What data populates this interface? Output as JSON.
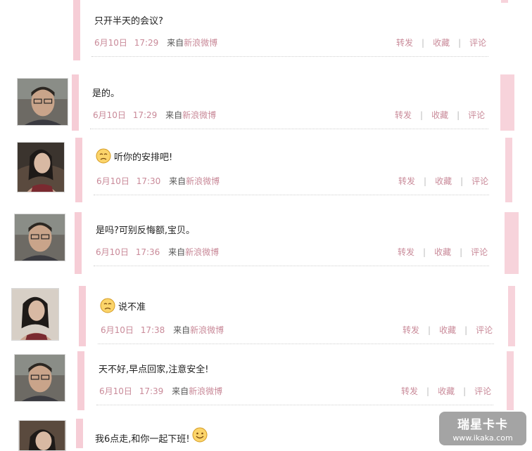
{
  "posts": [
    {
      "text": "只开半天的会议?",
      "date": "6月10日",
      "time": "17:29",
      "source_prefix": "来自",
      "source": "新浪微博",
      "actions": [
        "转发",
        "收藏",
        "评论"
      ],
      "avatar": "none",
      "emoji": ""
    },
    {
      "text": "是的。",
      "date": "6月10日",
      "time": "17:29",
      "source_prefix": "来自",
      "source": "新浪微博",
      "actions": [
        "转发",
        "收藏",
        "评论"
      ],
      "avatar": "man-avatar-icon",
      "emoji": ""
    },
    {
      "text": "听你的安排吧!",
      "date": "6月10日",
      "time": "17:30",
      "source_prefix": "来自",
      "source": "新浪微博",
      "actions": [
        "转发",
        "收藏",
        "评论"
      ],
      "avatar": "woman-avatar-icon",
      "emoji": "sad-face-icon"
    },
    {
      "text": "是吗?可别反悔额,宝贝。",
      "date": "6月10日",
      "time": "17:36",
      "source_prefix": "来自",
      "source": "新浪微博",
      "actions": [
        "转发",
        "收藏",
        "评论"
      ],
      "avatar": "man-avatar-icon",
      "emoji": ""
    },
    {
      "text": "说不准",
      "date": "6月10日",
      "time": "17:38",
      "source_prefix": "来自",
      "source": "新浪微博",
      "actions": [
        "转发",
        "收藏",
        "评论"
      ],
      "avatar": "woman-avatar-icon",
      "emoji": "sad-face-icon"
    },
    {
      "text": "天不好,早点回家,注意安全!",
      "date": "6月10日",
      "time": "17:39",
      "source_prefix": "来自",
      "source": "新浪微博",
      "actions": [
        "转发",
        "收藏",
        "评论"
      ],
      "avatar": "man-avatar-icon",
      "emoji": ""
    },
    {
      "text": "我6点走,和你一起下班!",
      "avatar": "woman-avatar-icon",
      "emoji_after": "smile-face-icon"
    }
  ],
  "watermark": {
    "logo": "瑞星卡卡",
    "url": "www.ikaka.com"
  },
  "colors": {
    "accent_bar": "#f6cdd6",
    "meta_text": "#c98a99"
  }
}
